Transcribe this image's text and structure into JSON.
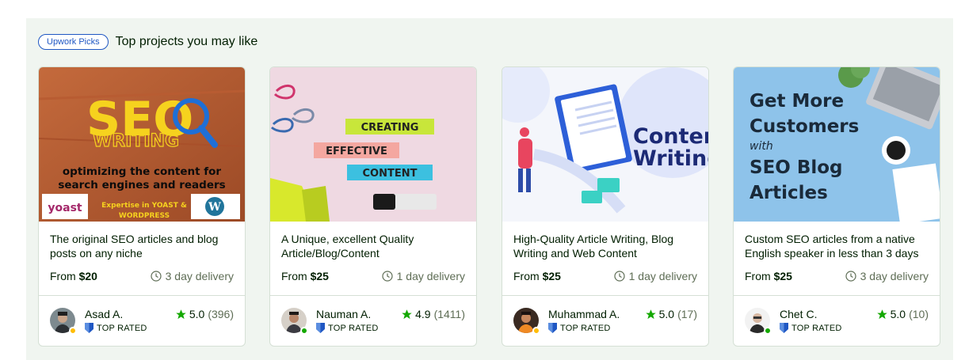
{
  "header": {
    "badge": "Upwork Picks",
    "title": "Top projects you may like"
  },
  "colors": {
    "accent_green": "#14a800",
    "badge_blue": "#1f57c3",
    "online": "#14a800",
    "away": "#ffbd05"
  },
  "cards": [
    {
      "title": "The original SEO articles and blog posts on any niche",
      "price_prefix": "From ",
      "price": "$20",
      "delivery": "3 day delivery",
      "seller": "Asad A.",
      "badge": "TOP RATED",
      "rating": "5.0",
      "reviews": "(396)",
      "status": "away",
      "thumb": {
        "big": "SEO",
        "sub": "WRITING",
        "line1": "optimizing the content for",
        "line2": "search engines and readers",
        "logo": "yoast",
        "strip1": "Expertise in YOAST &",
        "strip2": "WORDPRESS"
      }
    },
    {
      "title": "A Unique, excellent Quality Article/Blog/Content",
      "price_prefix": "From ",
      "price": "$25",
      "delivery": "1 day delivery",
      "seller": "Nauman A.",
      "badge": "TOP RATED",
      "rating": "4.9",
      "reviews": "(1411)",
      "status": "online",
      "thumb": {
        "w1": "CREATING",
        "w2": "EFFECTIVE",
        "w3": "CONTENT"
      }
    },
    {
      "title": "High-Quality Article Writing, Blog Writing and Web Content",
      "price_prefix": "From ",
      "price": "$25",
      "delivery": "1 day delivery",
      "seller": "Muhammad A.",
      "badge": "TOP RATED",
      "rating": "5.0",
      "reviews": "(17)",
      "status": "away",
      "thumb": {
        "w1": "Content",
        "w2": "Writing"
      }
    },
    {
      "title": "Custom SEO articles from a native English speaker in less than 3 days",
      "price_prefix": "From ",
      "price": "$25",
      "delivery": "3 day delivery",
      "seller": "Chet C.",
      "badge": "TOP RATED",
      "rating": "5.0",
      "reviews": "(10)",
      "status": "online",
      "thumb": {
        "l1": "Get More",
        "l2": "Customers",
        "l3": "with",
        "l4": "SEO Blog",
        "l5": "Articles"
      }
    }
  ]
}
